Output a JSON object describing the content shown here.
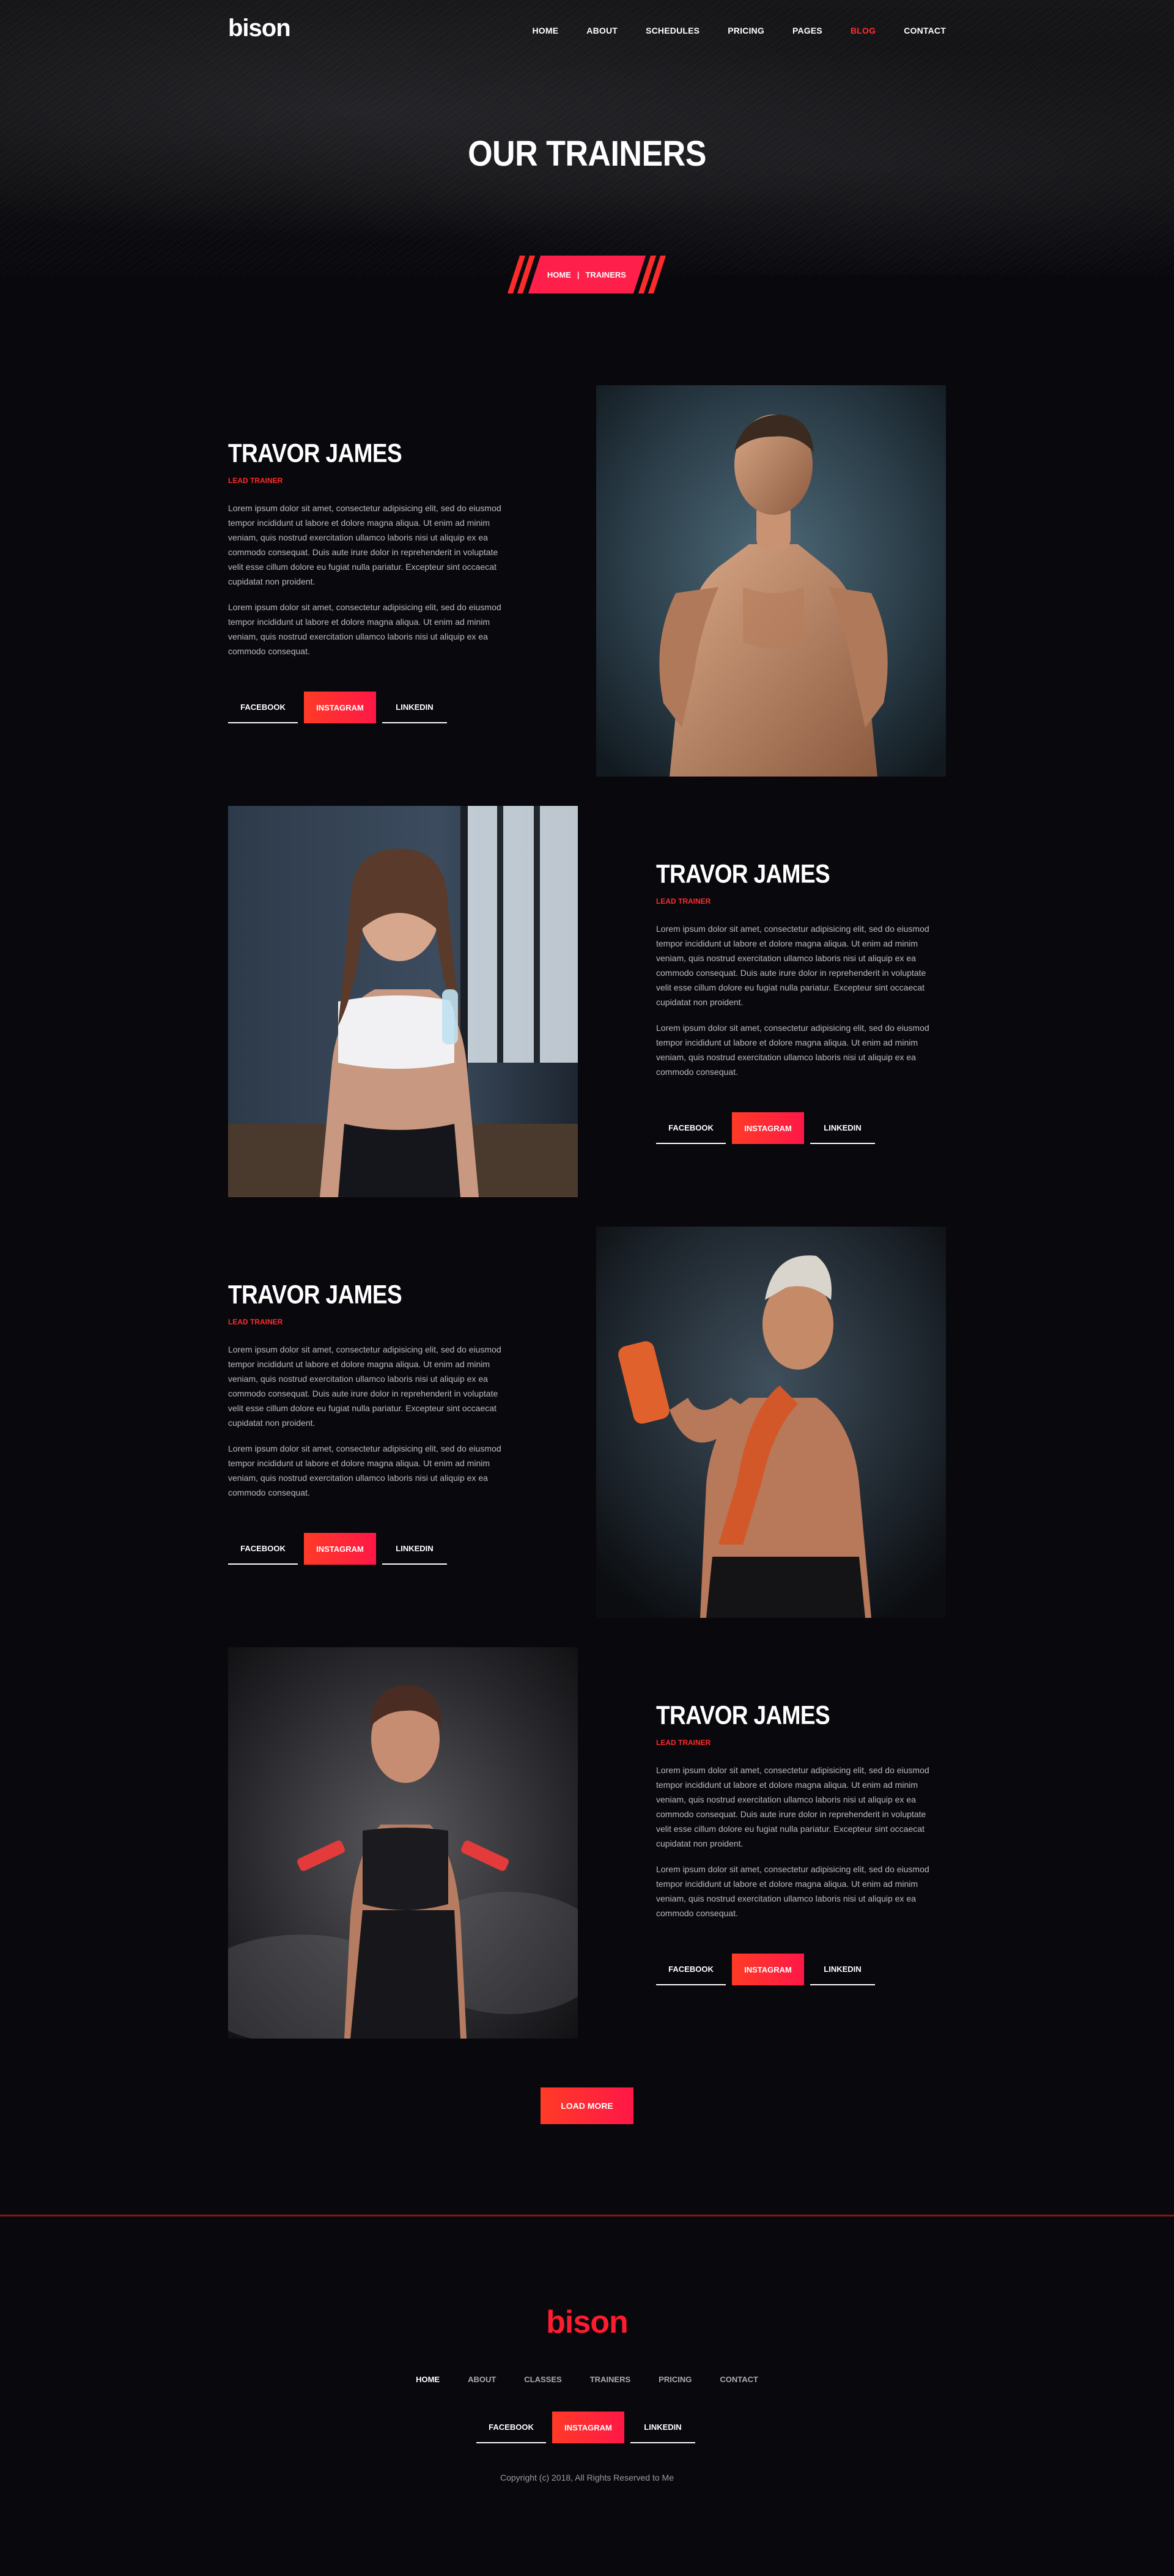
{
  "brand": {
    "logo": "bison"
  },
  "nav": {
    "items": [
      {
        "label": "HOME"
      },
      {
        "label": "ABOUT"
      },
      {
        "label": "SCHEDULES"
      },
      {
        "label": "PRICING"
      },
      {
        "label": "PAGES"
      },
      {
        "label": "BLOG"
      },
      {
        "label": "CONTACT"
      }
    ],
    "active": "BLOG"
  },
  "hero": {
    "title": "OUR TRAINERS",
    "breadcrumb": {
      "home": "HOME",
      "separator": "|",
      "current": "TRAINERS"
    }
  },
  "trainers": [
    {
      "name": "TRAVOR JAMES",
      "role": "LEAD TRAINER",
      "paragraph1": "Lorem ipsum dolor sit amet, consectetur adipisicing elit, sed do eiusmod tempor incididunt ut labore et dolore magna aliqua. Ut enim ad minim veniam, quis nostrud exercitation ullamco laboris nisi ut aliquip ex ea commodo consequat. Duis aute irure dolor in reprehenderit in voluptate velit esse cillum dolore eu fugiat nulla pariatur. Excepteur sint occaecat cupidatat non proident.",
      "paragraph2": "Lorem ipsum dolor sit amet, consectetur adipisicing elit, sed do eiusmod tempor incididunt ut labore et dolore magna aliqua. Ut enim ad minim veniam, quis nostrud exercitation ullamco laboris nisi ut aliquip ex ea commodo consequat.",
      "socials": {
        "facebook": "FACEBOOK",
        "instagram": "INSTAGRAM",
        "linkedin": "LINKEDIN"
      }
    },
    {
      "name": "TRAVOR JAMES",
      "role": "LEAD TRAINER",
      "paragraph1": "Lorem ipsum dolor sit amet, consectetur adipisicing elit, sed do eiusmod tempor incididunt ut labore et dolore magna aliqua. Ut enim ad minim veniam, quis nostrud exercitation ullamco laboris nisi ut aliquip ex ea commodo consequat. Duis aute irure dolor in reprehenderit in voluptate velit esse cillum dolore eu fugiat nulla pariatur. Excepteur sint occaecat cupidatat non proident.",
      "paragraph2": "Lorem ipsum dolor sit amet, consectetur adipisicing elit, sed do eiusmod tempor incididunt ut labore et dolore magna aliqua. Ut enim ad minim veniam, quis nostrud exercitation ullamco laboris nisi ut aliquip ex ea commodo consequat.",
      "socials": {
        "facebook": "FACEBOOK",
        "instagram": "INSTAGRAM",
        "linkedin": "LINKEDIN"
      }
    },
    {
      "name": "TRAVOR JAMES",
      "role": "LEAD TRAINER",
      "paragraph1": "Lorem ipsum dolor sit amet, consectetur adipisicing elit, sed do eiusmod tempor incididunt ut labore et dolore magna aliqua. Ut enim ad minim veniam, quis nostrud exercitation ullamco laboris nisi ut aliquip ex ea commodo consequat. Duis aute irure dolor in reprehenderit in voluptate velit esse cillum dolore eu fugiat nulla pariatur. Excepteur sint occaecat cupidatat non proident.",
      "paragraph2": "Lorem ipsum dolor sit amet, consectetur adipisicing elit, sed do eiusmod tempor incididunt ut labore et dolore magna aliqua. Ut enim ad minim veniam, quis nostrud exercitation ullamco laboris nisi ut aliquip ex ea commodo consequat.",
      "socials": {
        "facebook": "FACEBOOK",
        "instagram": "INSTAGRAM",
        "linkedin": "LINKEDIN"
      }
    },
    {
      "name": "TRAVOR JAMES",
      "role": "LEAD TRAINER",
      "paragraph1": "Lorem ipsum dolor sit amet, consectetur adipisicing elit, sed do eiusmod tempor incididunt ut labore et dolore magna aliqua. Ut enim ad minim veniam, quis nostrud exercitation ullamco laboris nisi ut aliquip ex ea commodo consequat. Duis aute irure dolor in reprehenderit in voluptate velit esse cillum dolore eu fugiat nulla pariatur. Excepteur sint occaecat cupidatat non proident.",
      "paragraph2": "Lorem ipsum dolor sit amet, consectetur adipisicing elit, sed do eiusmod tempor incididunt ut labore et dolore magna aliqua. Ut enim ad minim veniam, quis nostrud exercitation ullamco laboris nisi ut aliquip ex ea commodo consequat.",
      "socials": {
        "facebook": "FACEBOOK",
        "instagram": "INSTAGRAM",
        "linkedin": "LINKEDIN"
      }
    }
  ],
  "load_more": "LOAD MORE",
  "footer": {
    "logo": "bison",
    "nav": [
      {
        "label": "HOME"
      },
      {
        "label": "ABOUT"
      },
      {
        "label": "CLASSES"
      },
      {
        "label": "TRAINERS"
      },
      {
        "label": "PRICING"
      },
      {
        "label": "CONTACT"
      }
    ],
    "active": "HOME",
    "socials": {
      "facebook": "FACEBOOK",
      "instagram": "INSTAGRAM",
      "linkedin": "LINKEDIN"
    },
    "copyright": "Copyright (c) 2018, All Rights Reserved to Me"
  },
  "colors": {
    "accent": "#ff2b2b",
    "accent_pink": "#ff1747",
    "background": "#08080d",
    "body_text": "#b9b9bf"
  }
}
